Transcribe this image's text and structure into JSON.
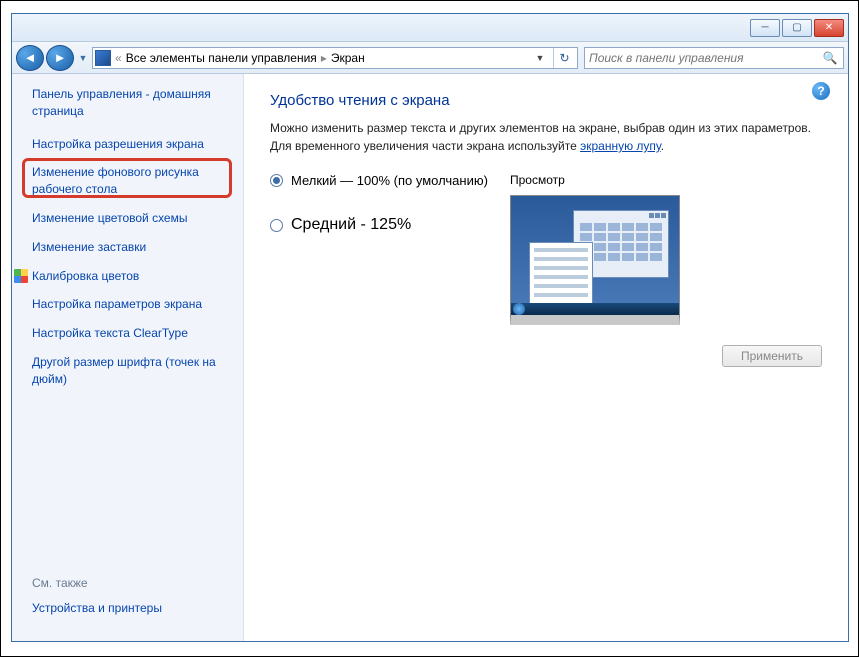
{
  "breadcrumb": {
    "sep": "«",
    "item1": "Все элементы панели управления",
    "arrow": "▸",
    "item2": "Экран"
  },
  "search": {
    "placeholder": "Поиск в панели управления"
  },
  "sidebar": {
    "home": "Панель управления - домашняя страница",
    "items": [
      "Настройка разрешения экрана",
      "Изменение фонового рисунка рабочего стола",
      "Изменение цветовой схемы",
      "Изменение заставки",
      "Калибровка цветов",
      "Настройка параметров экрана",
      "Настройка текста ClearType",
      "Другой размер шрифта (точек на дюйм)"
    ],
    "see_also_label": "См. также",
    "see_also_item": "Устройства и принтеры"
  },
  "main": {
    "heading": "Удобство чтения с экрана",
    "desc1": "Можно изменить размер текста и других элементов на экране, выбрав один из этих параметров. Для временного увеличения части экрана используйте ",
    "desc_link": "экранную лупу",
    "desc2": ".",
    "option_small": "Мелкий — 100% (по умолчанию)",
    "option_medium": "Средний - 125%",
    "preview_label": "Просмотр",
    "apply": "Применить"
  }
}
